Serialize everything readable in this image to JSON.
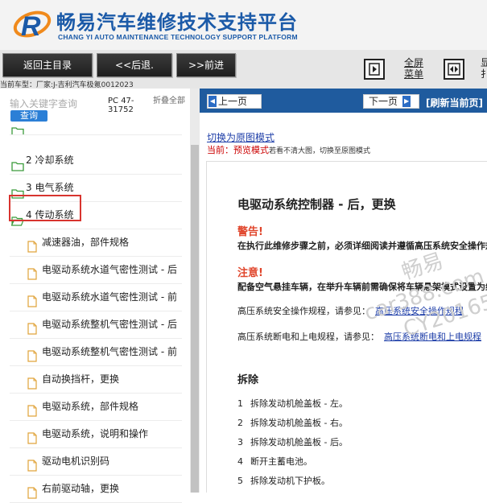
{
  "header": {
    "title_cn": "畅易汽车维修技术支持平台",
    "title_en": "CHANG YI AUTO MAINTENANCE TECHNOLOGY SUPPORT PLATFORM",
    "logo_icon": "chang-yi-logo",
    "brand_color": "#1b5aa8"
  },
  "toolbar": {
    "home_label": "返回主目录",
    "back_label": "<<后退.",
    "forward_label": ">>前进",
    "fullscreen_menu_line1": "全屏",
    "fullscreen_menu_line2": "菜单",
    "right_cut_line1": "显",
    "right_cut_line2": "扌",
    "vehicle_line": "当前车型：厂家:J-吉利汽车极氪0012023"
  },
  "sidebar": {
    "search_placeholder": "输入关键字查询",
    "search_button": "查询",
    "pc_code": "PC 47-31752",
    "collapse_all": "折叠全部",
    "tree": [
      {
        "type": "folder",
        "label": ""
      },
      {
        "type": "folder",
        "label": "2 冷却系统"
      },
      {
        "type": "folder",
        "label": "3 电气系统"
      },
      {
        "type": "folder",
        "label": "4 传动系统",
        "selected": true
      },
      {
        "type": "doc",
        "label": "减速器油，部件规格"
      },
      {
        "type": "doc",
        "label": "电驱动系统水道气密性测试 - 后"
      },
      {
        "type": "doc",
        "label": "电驱动系统水道气密性测试 - 前"
      },
      {
        "type": "doc",
        "label": "电驱动系统整机气密性测试 - 后"
      },
      {
        "type": "doc",
        "label": "电驱动系统整机气密性测试 - 前"
      },
      {
        "type": "doc",
        "label": "自动换挡杆，更换"
      },
      {
        "type": "doc",
        "label": "电驱动系统，部件规格"
      },
      {
        "type": "doc",
        "label": "电驱动系统，说明和操作"
      },
      {
        "type": "doc",
        "label": "驱动电机识别码"
      },
      {
        "type": "doc",
        "label": "右前驱动轴，更换"
      }
    ]
  },
  "content": {
    "prev_page": "上一页",
    "next_page": "下一页",
    "refresh": "[刷新当前页]",
    "switch_link": "切换为原图模式",
    "mode_prefix": "当前：",
    "mode_value": "预览模式",
    "mode_hint": "若看不清大图，切换至原图模式",
    "doc": {
      "title": "电驱动系统控制器 - 后，更换",
      "warning_heading": "警告!",
      "warning_text": "在执行此维修步骤之前，必须详细阅读并遵循高压系统安全操作规程",
      "caution_heading": "注意!",
      "caution_text": "配备空气悬挂车辆，在举升车辆前需确保将车辆悬架模式设置为维修模式",
      "ref1_text": "高压系统安全操作规程，请参见：",
      "ref1_link": "高压系统安全操作规程",
      "ref2_text": "高压系统断电和上电规程，请参见：",
      "ref2_link": "高压系统断电和上电规程",
      "remove_heading": "拆除",
      "steps": [
        {
          "n": "1",
          "text": "拆除发动机舱盖板 - 左。"
        },
        {
          "n": "2",
          "text": "拆除发动机舱盖板 - 右。"
        },
        {
          "n": "3",
          "text": "拆除发动机舱盖板 - 后。"
        },
        {
          "n": "4",
          "text": "断开主蓄电池。"
        },
        {
          "n": "5",
          "text": "拆除发动机下护板。"
        }
      ]
    },
    "watermark_lines": [
      "畅易",
      "car388.com",
      "CY20165"
    ],
    "accent_color": "#1f5b9e",
    "warning_color": "#e0452b"
  }
}
